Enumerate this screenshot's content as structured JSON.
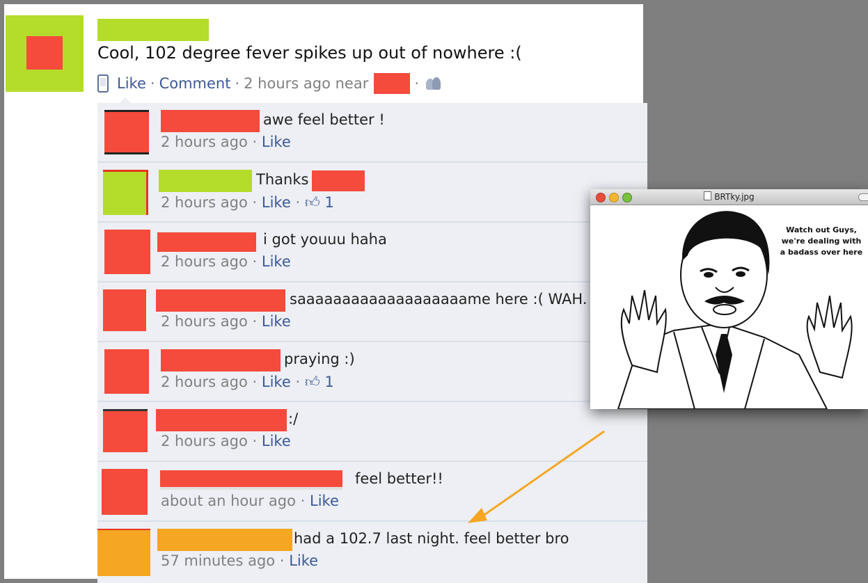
{
  "post": {
    "status": "Cool, 102 degree fever spikes up out of nowhere :(",
    "like_label": "Like",
    "comment_label": "Comment",
    "timestamp": "2 hours ago near",
    "sep": "·"
  },
  "comments": [
    {
      "text": "awe feel better !",
      "time": "2 hours ago",
      "like": "Like",
      "likes": ""
    },
    {
      "text": "Thanks",
      "time": "2 hours ago",
      "like": "Like",
      "likes": "1"
    },
    {
      "text": "i got youuu haha",
      "time": "2 hours ago",
      "like": "Like",
      "likes": ""
    },
    {
      "text": "saaaaaaaaaaaaaaaaaaame here :( WAH.",
      "time": "2 hours ago",
      "like": "Like",
      "likes": ""
    },
    {
      "text": "praying :)",
      "time": "2 hours ago",
      "like": "Like",
      "likes": "1"
    },
    {
      "text": ":/",
      "time": "2 hours ago",
      "like": "Like",
      "likes": ""
    },
    {
      "text": "feel better!!",
      "time": "about an hour ago",
      "like": "Like",
      "likes": ""
    },
    {
      "text": "had a 102.7 last night. feel better bro",
      "time": "57 minutes ago",
      "like": "Like",
      "likes": ""
    }
  ],
  "image_window": {
    "title": "BRTky.jpg",
    "caption": "Watch out Guys, we're dealing with a badass over here"
  },
  "colors": {
    "link": "#3b5998",
    "redact_red": "#f44b3c",
    "redact_green": "#b4dc2a",
    "redact_orange": "#f5a623",
    "arrow": "#f5a623"
  }
}
